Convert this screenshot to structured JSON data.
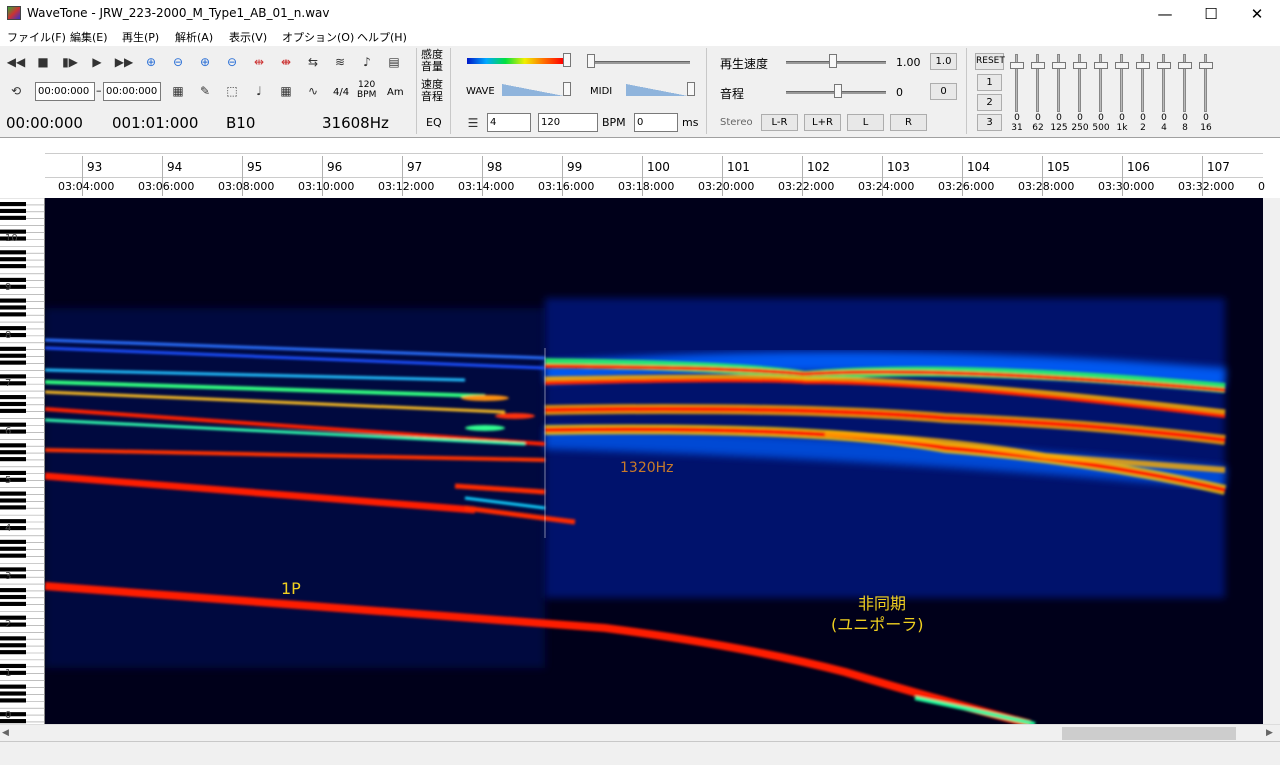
{
  "window": {
    "title": "WaveTone - JRW_223-2000_M_Type1_AB_01_n.wav"
  },
  "window_controls": {
    "minimize": "—",
    "maximize": "☐",
    "close": "✕"
  },
  "menu": [
    "ファイル(F)",
    "編集(E)",
    "再生(P)",
    "解析(A)",
    "表示(V)",
    "オプション(O)",
    "ヘルプ(H)"
  ],
  "toolbar": {
    "range_start": "00:00:000",
    "range_sep": "–",
    "range_end": "00:00:000",
    "time_sig": "4/4",
    "bpm_icon_top": "120",
    "bpm_icon_bottom": "BPM",
    "am_label": "Am",
    "position_time": "00:00:000",
    "position_measure": "001:01:000",
    "note_readout": "B10",
    "freq_readout": "31608Hz",
    "sens_label_top": "感度",
    "sens_label_bottom": "音量",
    "speed_label_top": "速度",
    "speed_label_bottom": "音程",
    "eq_label": "EQ",
    "wave_label": "WAVE",
    "midi_label": "MIDI",
    "beats_value": "4",
    "bpm_value": "120",
    "bpm_unit": "BPM",
    "ms_value": "0",
    "ms_unit": "ms",
    "play_speed_label": "再生速度",
    "play_speed_value": "1.00",
    "play_speed_reset": "1.0",
    "pitch_label": "音程",
    "pitch_value": "0",
    "pitch_reset": "0",
    "stereo_label": "Stereo",
    "channel_buttons": [
      "L-R",
      "L+R",
      "L",
      "R"
    ],
    "reset_label": "RESET",
    "preset_buttons": [
      "1",
      "2",
      "3"
    ],
    "eq_bands": [
      {
        "gain": "0",
        "freq": "31"
      },
      {
        "gain": "0",
        "freq": "62"
      },
      {
        "gain": "0",
        "freq": "125"
      },
      {
        "gain": "0",
        "freq": "250"
      },
      {
        "gain": "0",
        "freq": "500"
      },
      {
        "gain": "0",
        "freq": "1k"
      },
      {
        "gain": "0",
        "freq": "2"
      },
      {
        "gain": "0",
        "freq": "4"
      },
      {
        "gain": "0",
        "freq": "8"
      },
      {
        "gain": "0",
        "freq": "16"
      }
    ]
  },
  "ruler": {
    "measures": [
      "93",
      "94",
      "95",
      "96",
      "97",
      "98",
      "99",
      "100",
      "101",
      "102",
      "103",
      "104",
      "105",
      "106",
      "107"
    ],
    "times": [
      "03:04:000",
      "03:06:000",
      "03:08:000",
      "03:10:000",
      "03:12:000",
      "03:14:000",
      "03:16:000",
      "03:18:000",
      "03:20:000",
      "03:22:000",
      "03:24:000",
      "03:26:000",
      "03:28:000",
      "03:30:000",
      "03:32:000",
      "0"
    ]
  },
  "octaves": [
    "10",
    "9",
    "8",
    "7",
    "6",
    "5",
    "4",
    "3",
    "2",
    "1",
    "0"
  ],
  "annotations": {
    "freq_label": "1320Hz",
    "p1_label": "1P",
    "async_label": "非同期",
    "async_sub": "(ユニポーラ)"
  },
  "colors": {
    "freq_label": "#c87a2a",
    "annotation": "#f0d020",
    "spectro_bg": "#00001a",
    "harmonic_red": "#ff1a00"
  }
}
